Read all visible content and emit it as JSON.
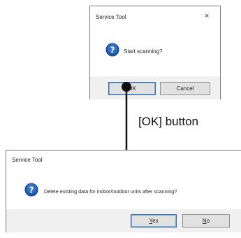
{
  "dialog1": {
    "title": "Service Tool",
    "close_glyph": "×",
    "icon": "question-icon",
    "message": "Start scanning?",
    "ok_label": "OK",
    "cancel_label": "Cancel"
  },
  "dialog2": {
    "title": "Service Tool",
    "icon": "question-icon",
    "message": "Delete existing data for indoor/outdoor units after scanning?",
    "yes_label": "Yes",
    "no_label": "No"
  },
  "annotation": {
    "label": "[OK] button"
  },
  "colors": {
    "question_icon": "#1e5bb0",
    "dialog_border": "#7a7a7a",
    "button_bar": "#f0f0f0",
    "default_button_border": "#3a6ea5"
  }
}
